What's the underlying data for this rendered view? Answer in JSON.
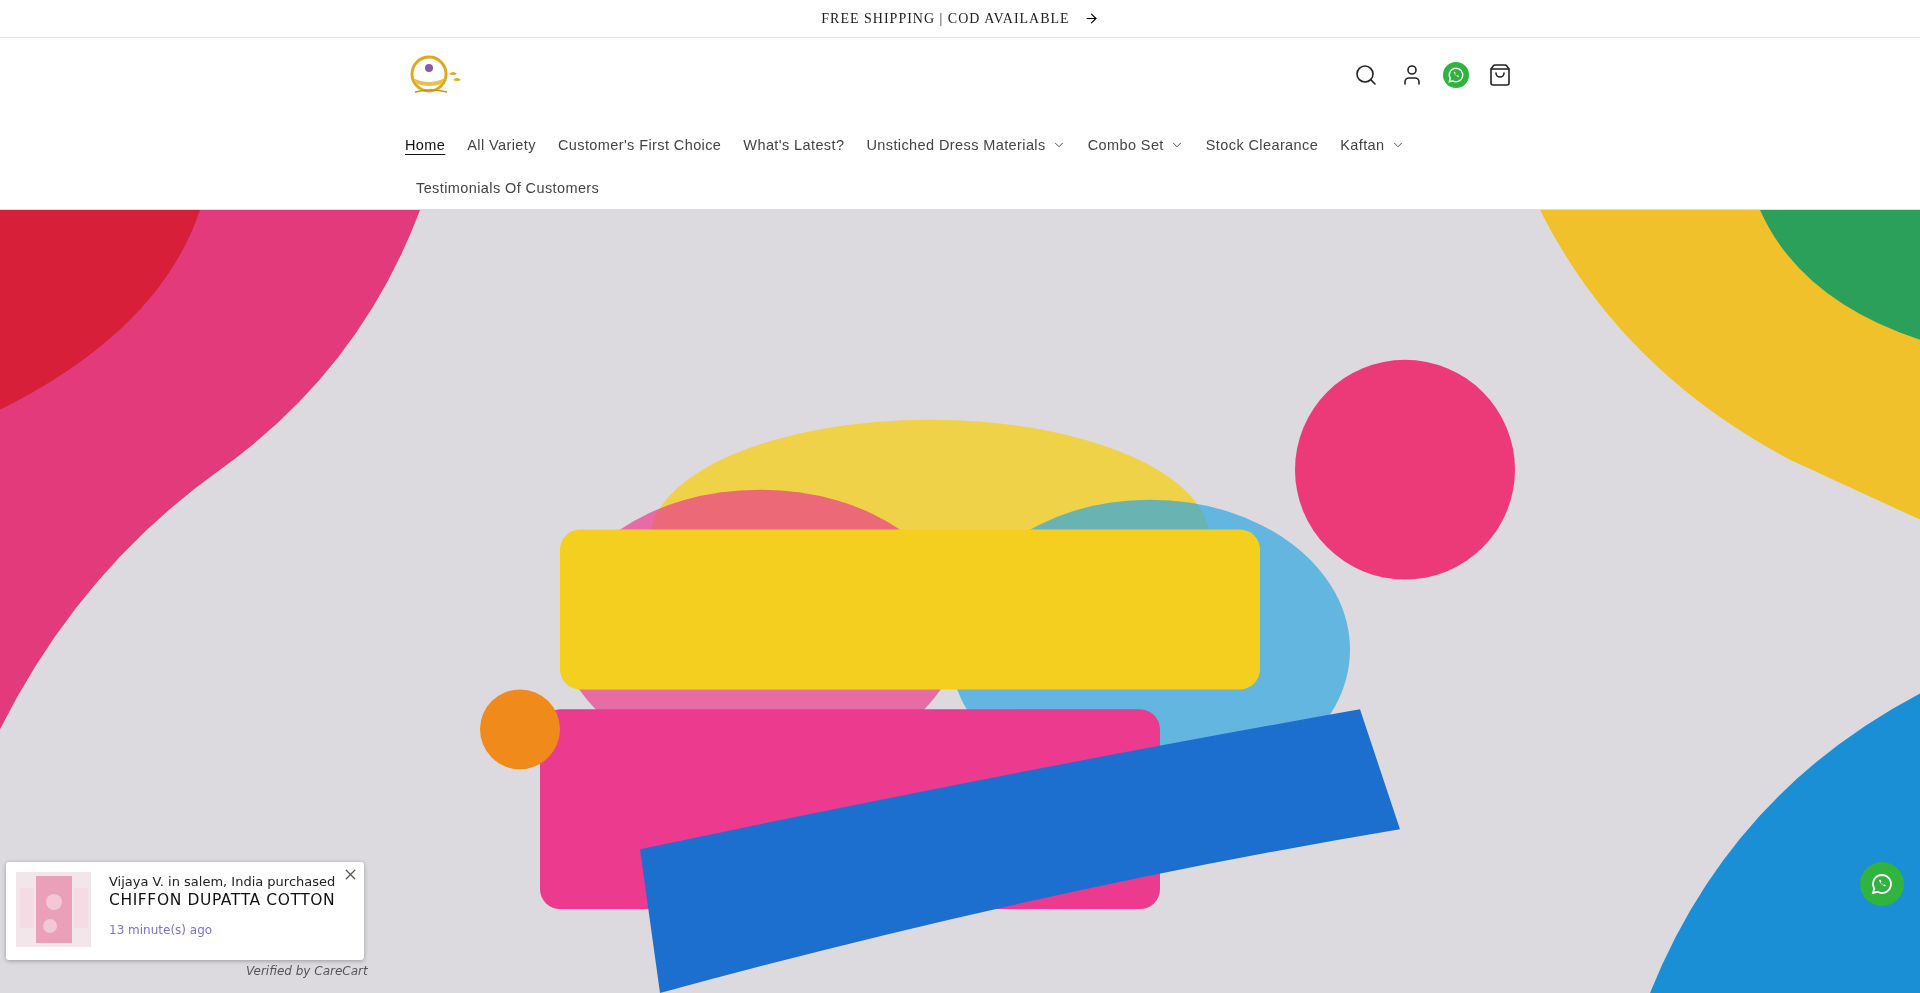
{
  "announcement": {
    "text": "FREE SHIPPING | COD AVAILABLE"
  },
  "nav": [
    {
      "label": "Home",
      "selected": true,
      "dropdown": false
    },
    {
      "label": "All Variety",
      "selected": false,
      "dropdown": false
    },
    {
      "label": "Customer's First Choice",
      "selected": false,
      "dropdown": false
    },
    {
      "label": "What's Latest?",
      "selected": false,
      "dropdown": false
    },
    {
      "label": "Unstiched Dress Materials",
      "selected": false,
      "dropdown": true
    },
    {
      "label": "Combo Set",
      "selected": false,
      "dropdown": true
    },
    {
      "label": "Stock Clearance",
      "selected": false,
      "dropdown": false
    },
    {
      "label": "Kaftan",
      "selected": false,
      "dropdown": true
    },
    {
      "label": "Testimonials Of Customers",
      "selected": false,
      "dropdown": false
    }
  ],
  "purchase_popup": {
    "buyer": "Vijaya V. in salem, India purchased",
    "product": "CHIFFON DUPATTA COTTON",
    "time": "13 minute(s) ago",
    "verified": "Verified by CareCart"
  }
}
